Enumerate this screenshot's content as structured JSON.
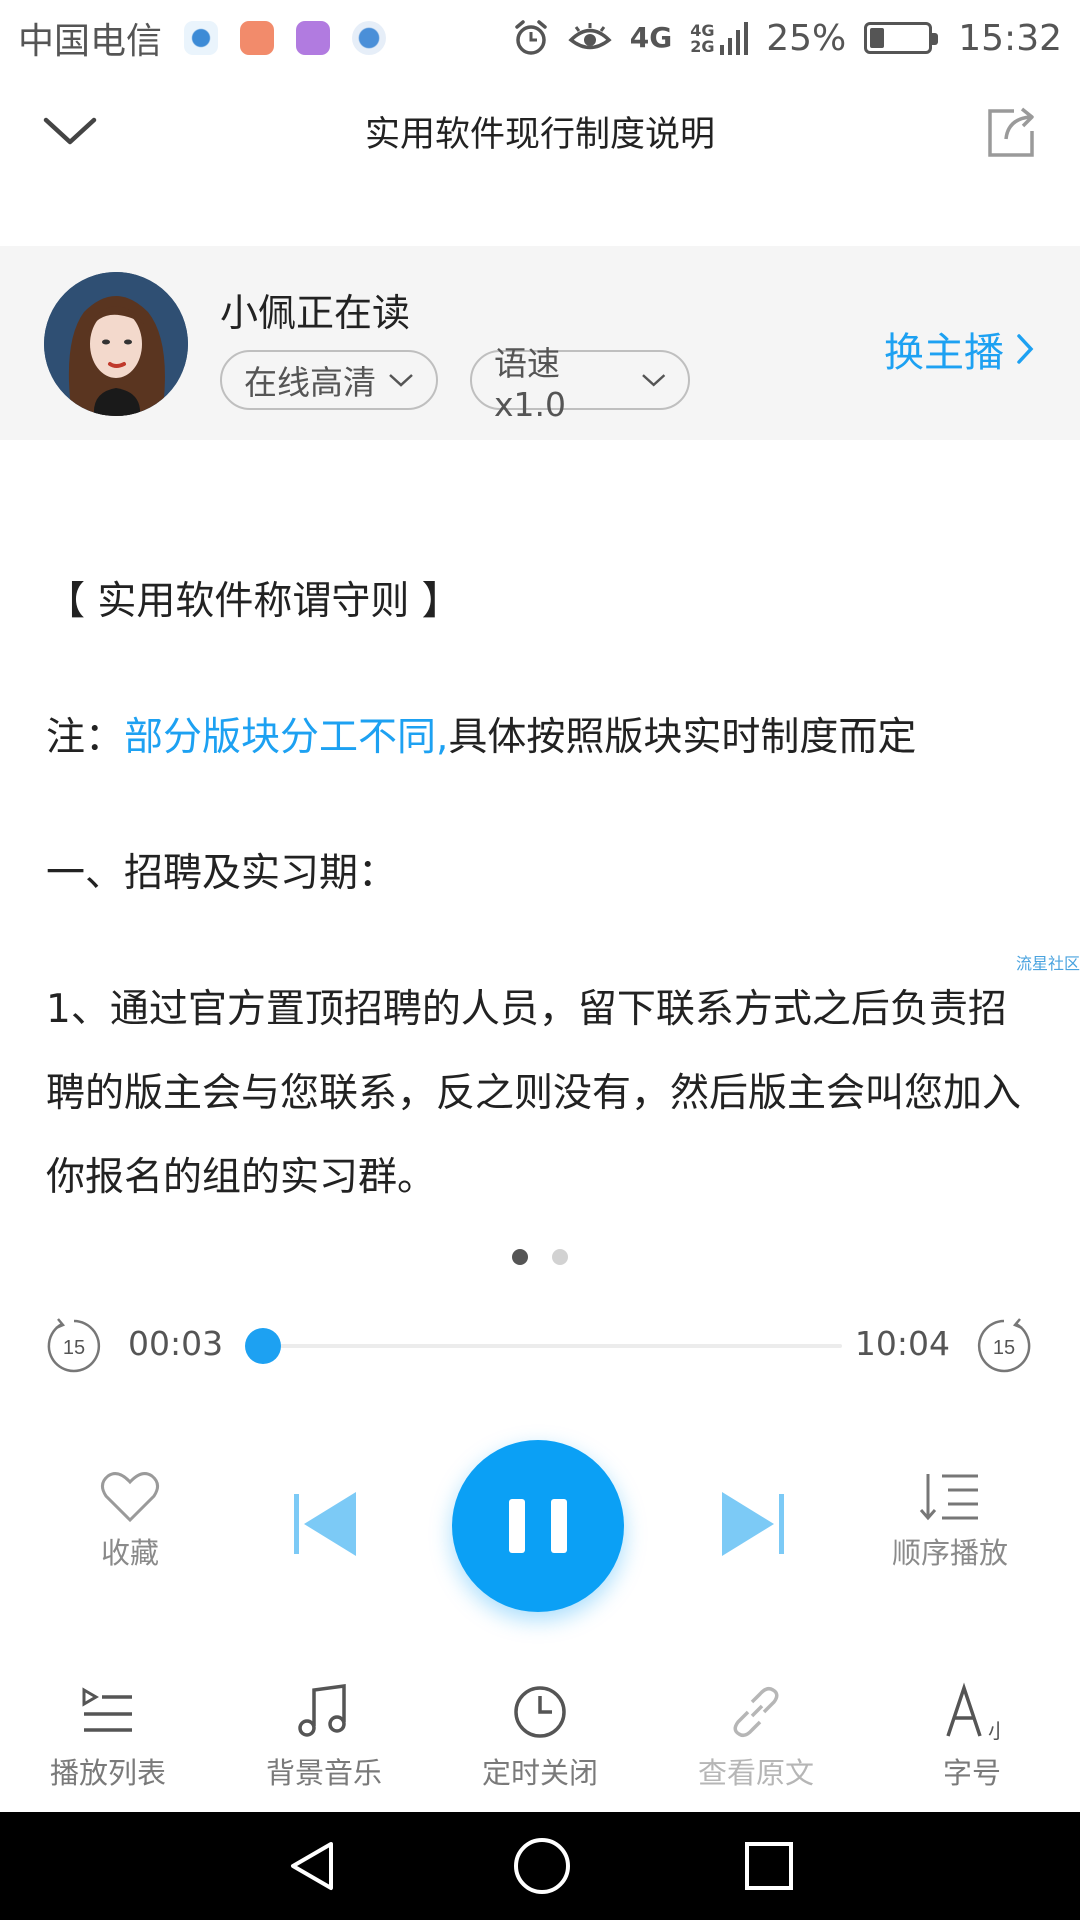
{
  "status_bar": {
    "carrier": "中国电信",
    "network": "4G",
    "network2": "4G 2G",
    "battery": "25%",
    "battery_level": 0.25,
    "time": "15:32"
  },
  "header": {
    "title": "实用软件现行制度说明"
  },
  "anchor": {
    "name": "小佩正在读",
    "quality": "在线高清",
    "speed": "语速x1.0",
    "switch_label": "换主播"
  },
  "article": {
    "heading": "【 实用软件称谓守则 】",
    "note_prefix": "注：",
    "note_highlight": "部分版块分工不同,",
    "note_rest": "具体按照版块实时制度而定",
    "section": "一、招聘及实习期：",
    "paragraph": "1、通过官方置顶招聘的人员，留下联系方式之后负责招聘的版主会与您联系，反之则没有，然后版主会叫您加入你报名的组的实习群。",
    "watermark": "流星社区"
  },
  "pages": {
    "count": 2,
    "active": 0
  },
  "player": {
    "current_time": "00:03",
    "total_time": "10:04",
    "progress": 0.005,
    "skip_seconds": "15",
    "favorite_label": "收藏",
    "order_label": "顺序播放"
  },
  "toolbar": {
    "items": [
      {
        "label": "播放列表",
        "icon": "playlist-icon"
      },
      {
        "label": "背景音乐",
        "icon": "music-note-icon"
      },
      {
        "label": "定时关闭",
        "icon": "clock-icon"
      },
      {
        "label": "查看原文",
        "icon": "link-icon"
      },
      {
        "label": "字号",
        "icon": "font-size-icon"
      }
    ]
  },
  "colors": {
    "accent": "#1da1f2",
    "play_button": "#0ba0f5",
    "anchor_bg": "#f5f5f5"
  }
}
